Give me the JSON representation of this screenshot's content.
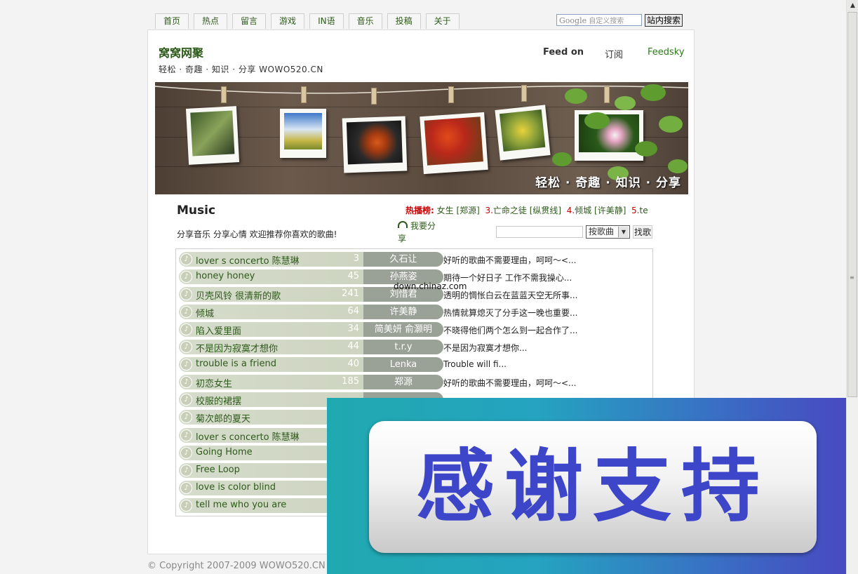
{
  "nav": {
    "tabs": [
      "首页",
      "热点",
      "留言",
      "游戏",
      "IN语",
      "音乐",
      "投稿",
      "关于"
    ],
    "search_placeholder_brand": "Google",
    "search_placeholder": "自定义搜索",
    "search_button": "站内搜索"
  },
  "header": {
    "site_title": "窝窝网聚",
    "subtitle": "轻松 · 奇趣 · 知识 · 分享 WOWO520.CN",
    "feed_on": "Feed on",
    "subscribe": "订阅",
    "feedsky": "Feedsky"
  },
  "banner": {
    "slogan": "轻松 · 奇趣 · 知识 · 分享"
  },
  "music": {
    "title": "Music",
    "hotlist_label": "热播榜:",
    "hotlist": [
      {
        "num": "",
        "text": "女生 [郑源]"
      },
      {
        "num": "3.",
        "text": "亡命之徒 [纵贯线]"
      },
      {
        "num": "4.",
        "text": "倾城 [许美静]"
      },
      {
        "num": "5.",
        "text": "te"
      }
    ],
    "description": "分享音乐 分享心情 欢迎推荐你喜欢的歌曲!",
    "recommend": "我要分享",
    "search_by": "按歌曲",
    "find": "找歌"
  },
  "songs": [
    {
      "name": "lover s concerto 陈慧琳",
      "count": "3",
      "singer": "久石让",
      "comment": "好听的歌曲不需要理由，呵呵～<..."
    },
    {
      "name": "honey honey",
      "count": "45",
      "singer": "孙燕姿",
      "comment": "期待一个好日子 工作不需我操心..."
    },
    {
      "name": "贝壳风铃 很清新的歌",
      "count": "241",
      "singer": "刘惜君",
      "comment": "透明的惆怅白云在蓝蓝天空无所事..."
    },
    {
      "name": "倾城",
      "count": "64",
      "singer": "许美静",
      "comment": "热情就算熄灭了分手这一晚也重要..."
    },
    {
      "name": "陷入爱里面",
      "count": "34",
      "singer": "简美妍 俞灏明",
      "comment": "不晓得他们两个怎么到一起合作了..."
    },
    {
      "name": "不是因为寂寞才想你",
      "count": "44",
      "singer": "t.r.y",
      "comment": "不是因为寂寞才想你..."
    },
    {
      "name": "trouble is a friend",
      "count": "40",
      "singer": "Lenka",
      "comment": "Trouble will fi..."
    },
    {
      "name": "初恋女生",
      "count": "185",
      "singer": "郑源",
      "comment": "好听的歌曲不需要理由，呵呵～<..."
    },
    {
      "name": "校服的裙摆",
      "count": "",
      "singer": "",
      "comment": ""
    },
    {
      "name": "菊次郎的夏天",
      "count": "",
      "singer": "",
      "comment": ""
    },
    {
      "name": "lover s concerto 陈慧琳",
      "count": "",
      "singer": "",
      "comment": ""
    },
    {
      "name": "Going Home",
      "count": "",
      "singer": "",
      "comment": ""
    },
    {
      "name": "Free Loop",
      "count": "",
      "singer": "",
      "comment": ""
    },
    {
      "name": "love is color blind",
      "count": "",
      "singer": "",
      "comment": ""
    },
    {
      "name": "tell me who you are",
      "count": "",
      "singer": "",
      "comment": ""
    }
  ],
  "watermark": "down.chinaz.com",
  "copyright": "© Copyright 2007-2009 WOWO520.CN R",
  "overlay": {
    "text": "感谢支持"
  },
  "colors": {
    "accent_green": "#2d5a1a",
    "overlay_text": "#3d45c8"
  }
}
